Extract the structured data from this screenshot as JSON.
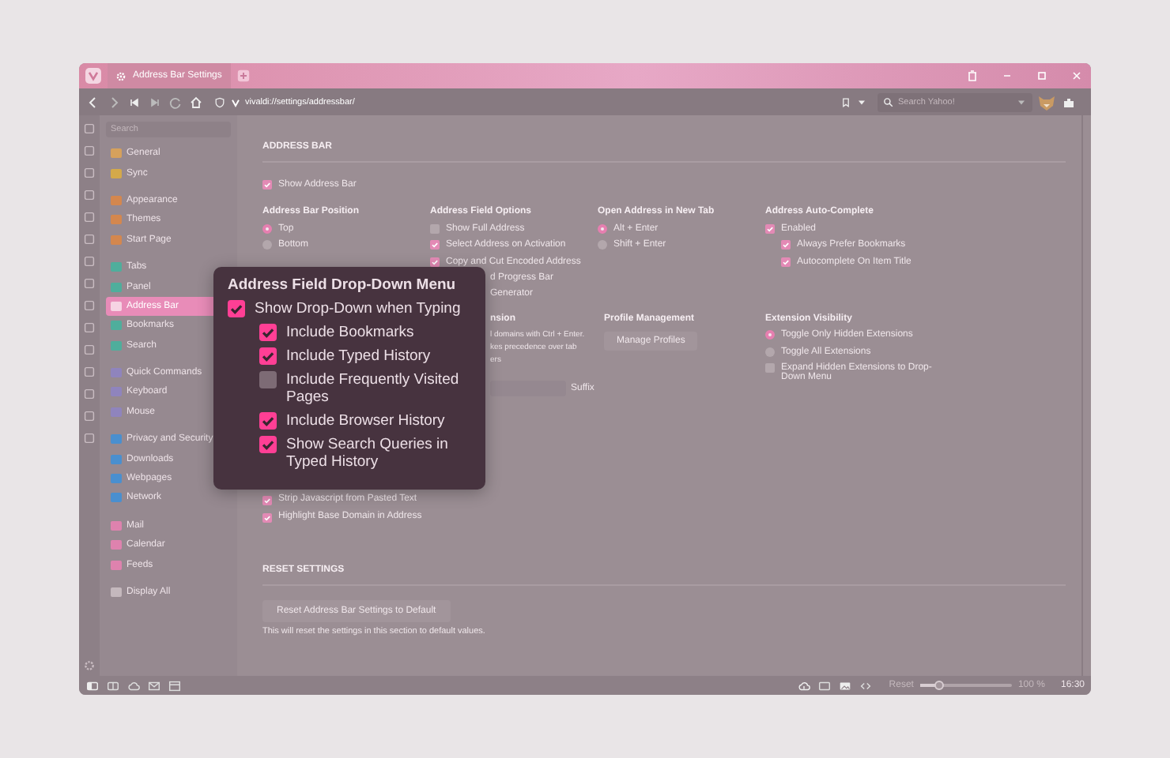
{
  "window": {
    "tab_title": "Address Bar Settings"
  },
  "toolbar": {
    "url": "vivaldi://settings/addressbar/",
    "search_placeholder": "Search Yahoo!"
  },
  "sidebar": {
    "search_placeholder": "Search",
    "groups": [
      {
        "items": [
          {
            "label": "General",
            "color": "#d6a15c",
            "selected": false
          },
          {
            "label": "Sync",
            "color": "#d4a94a",
            "selected": false
          }
        ]
      },
      {
        "items": [
          {
            "label": "Appearance",
            "color": "#d4874e",
            "selected": false
          },
          {
            "label": "Themes",
            "color": "#d4874e",
            "selected": false
          },
          {
            "label": "Start Page",
            "color": "#d4874e",
            "selected": false
          }
        ]
      },
      {
        "items": [
          {
            "label": "Tabs",
            "color": "#4fae9c",
            "selected": false
          },
          {
            "label": "Panel",
            "color": "#4fae9c",
            "selected": false
          },
          {
            "label": "Address Bar",
            "color": "#f6d3e3",
            "selected": true
          },
          {
            "label": "Bookmarks",
            "color": "#4fae9c",
            "selected": false
          },
          {
            "label": "Search",
            "color": "#4fae9c",
            "selected": false
          }
        ]
      },
      {
        "items": [
          {
            "label": "Quick Commands",
            "color": "#8f84bd",
            "selected": false
          },
          {
            "label": "Keyboard",
            "color": "#8f84bd",
            "selected": false
          },
          {
            "label": "Mouse",
            "color": "#8f84bd",
            "selected": false
          }
        ]
      },
      {
        "items": [
          {
            "label": "Privacy and Security",
            "color": "#4a8fcf",
            "selected": false
          },
          {
            "label": "Downloads",
            "color": "#4a8fcf",
            "selected": false
          },
          {
            "label": "Webpages",
            "color": "#4a8fcf",
            "selected": false
          },
          {
            "label": "Network",
            "color": "#4a8fcf",
            "selected": false
          }
        ]
      },
      {
        "items": [
          {
            "label": "Mail",
            "color": "#de82ae",
            "selected": false
          },
          {
            "label": "Calendar",
            "color": "#de82ae",
            "selected": false
          },
          {
            "label": "Feeds",
            "color": "#de82ae",
            "selected": false
          }
        ]
      },
      {
        "items": [
          {
            "label": "Display All",
            "color": "#c4b8bd",
            "selected": false
          }
        ]
      }
    ]
  },
  "address_bar": {
    "heading": "ADDRESS BAR",
    "show": {
      "label": "Show Address Bar",
      "checked": true
    },
    "row_1": [
      {
        "title": "Address Bar Position",
        "options": [
          {
            "kind": "radio",
            "label": "Top",
            "selected": true
          },
          {
            "kind": "radio",
            "label": "Bottom",
            "selected": false
          }
        ]
      },
      {
        "title": "Address Field Options",
        "options": [
          {
            "kind": "checkbox",
            "label": "Show Full Address",
            "checked": false
          },
          {
            "kind": "checkbox",
            "label": "Select Address on Activation",
            "checked": true
          },
          {
            "kind": "checkbox",
            "label": "Copy and Cut Encoded Address",
            "checked": true
          },
          {
            "kind": "fragment",
            "label": "d Progress Bar"
          },
          {
            "kind": "fragment",
            "label": "Generator"
          }
        ]
      },
      {
        "title": "Open Address in New Tab",
        "options": [
          {
            "kind": "radio",
            "label": "Alt + Enter",
            "selected": true
          },
          {
            "kind": "radio",
            "label": "Shift + Enter",
            "selected": false
          }
        ]
      },
      {
        "title": "Address Auto-Complete",
        "options": [
          {
            "kind": "checkbox",
            "label": "Enabled",
            "checked": true
          },
          {
            "kind": "subcheckbox",
            "label": "Always Prefer Bookmarks",
            "checked": true
          },
          {
            "kind": "subcheckbox",
            "label": "Autocomplete On Item Title",
            "checked": true
          }
        ]
      }
    ],
    "row_2": [
      {
        "options": [
          {
            "kind": "checkbox",
            "label": "Strip Javascript from Pasted Text",
            "checked": true
          },
          {
            "kind": "checkbox",
            "label": "Highlight Base Domain in Address",
            "checked": true
          }
        ]
      },
      {
        "title": "nsion",
        "options": [
          {
            "kind": "fragment",
            "label": "l domains with Ctrl + Enter."
          },
          {
            "kind": "fragment",
            "label": "kes precedence over tab"
          },
          {
            "kind": "fragment",
            "label": "ers"
          },
          {
            "kind": "field",
            "label": "Suffix"
          }
        ]
      },
      {
        "title": "Profile Management",
        "options": [
          {
            "kind": "button",
            "label": "Manage Profiles"
          }
        ]
      },
      {
        "title": "Extension Visibility",
        "options": [
          {
            "kind": "radio",
            "label": "Toggle Only Hidden Extensions",
            "selected": true
          },
          {
            "kind": "radio",
            "label": "Toggle All Extensions",
            "selected": false
          },
          {
            "kind": "checkbox",
            "label": "Expand Hidden Extensions to Drop-Down Menu",
            "checked": false
          }
        ]
      }
    ]
  },
  "reset": {
    "heading": "RESET SETTINGS",
    "button": "Reset Address Bar Settings to Default",
    "note": "This will reset the settings in this section to default values."
  },
  "popup": {
    "title": "Address Field Drop-Down Menu",
    "options": [
      {
        "label": "Show Drop-Down when Typing",
        "checked": true,
        "children": [
          {
            "label": "Include Bookmarks",
            "checked": true
          },
          {
            "label": "Include Typed History",
            "checked": true
          },
          {
            "label": "Include Frequently Visited Pages",
            "checked": false
          },
          {
            "label": "Include Browser History",
            "checked": true
          },
          {
            "label": "Show Search Queries in Typed History",
            "checked": true
          }
        ]
      }
    ]
  },
  "status_bar": {
    "reset_label": "Reset",
    "zoom": {
      "level": 0.2
    },
    "zoom_value": "100 %",
    "clock": "16:30"
  }
}
